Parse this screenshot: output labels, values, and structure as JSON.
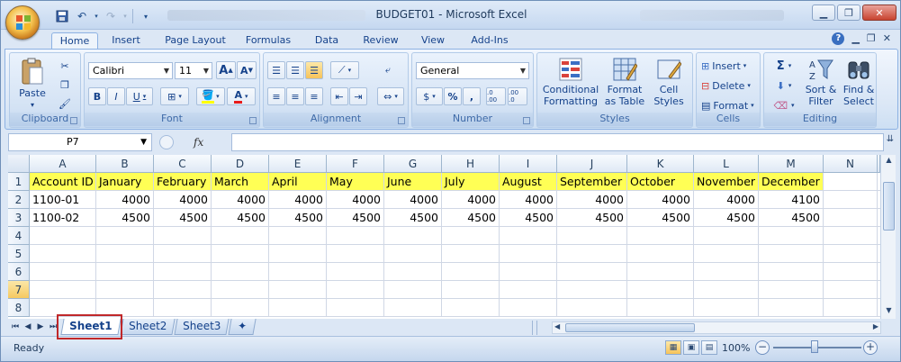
{
  "window": {
    "title": "BUDGET01 - Microsoft Excel"
  },
  "tabs": [
    "Home",
    "Insert",
    "Page Layout",
    "Formulas",
    "Data",
    "Review",
    "View",
    "Add-Ins"
  ],
  "ribbon": {
    "clipboard": {
      "label": "Clipboard",
      "paste": "Paste"
    },
    "font": {
      "label": "Font",
      "name": "Calibri",
      "size": "11",
      "bold": "B",
      "italic": "I",
      "underline": "U",
      "grow": "A",
      "shrink": "A"
    },
    "alignment": {
      "label": "Alignment"
    },
    "number": {
      "label": "Number",
      "format": "General",
      "currency": "$",
      "percent": "%",
      "comma": ",",
      "inc_dec": ".0 .00",
      "dec_dec": ".00 .0"
    },
    "styles": {
      "label": "Styles",
      "conditional": "Conditional Formatting",
      "format_table": "Format as Table",
      "cell_styles": "Cell Styles"
    },
    "cells": {
      "label": "Cells",
      "insert": "Insert",
      "delete": "Delete",
      "format": "Format"
    },
    "editing": {
      "label": "Editing",
      "sum": "Σ",
      "sort": "Sort & Filter",
      "find": "Find & Select"
    }
  },
  "formula_bar": {
    "name_box": "P7",
    "fx": "fx",
    "formula": ""
  },
  "columns": [
    "A",
    "B",
    "C",
    "D",
    "E",
    "F",
    "G",
    "H",
    "I",
    "J",
    "K",
    "L",
    "M",
    "N"
  ],
  "rows": [
    "1",
    "2",
    "3",
    "4",
    "5",
    "6",
    "7",
    "8"
  ],
  "sheet": {
    "header": [
      "Account ID",
      "January",
      "February",
      "March",
      "April",
      "May",
      "June",
      "July",
      "August",
      "September",
      "October",
      "November",
      "December"
    ],
    "data": [
      [
        "1100-01",
        "4000",
        "4000",
        "4000",
        "4000",
        "4000",
        "4000",
        "4000",
        "4000",
        "4000",
        "4000",
        "4000",
        "4100"
      ],
      [
        "1100-02",
        "4500",
        "4500",
        "4500",
        "4500",
        "4500",
        "4500",
        "4500",
        "4500",
        "4500",
        "4500",
        "4500",
        "4500"
      ]
    ]
  },
  "sheet_tabs": [
    "Sheet1",
    "Sheet2",
    "Sheet3"
  ],
  "status": {
    "ready": "Ready",
    "zoom": "100%",
    "minus": "−",
    "plus": "+"
  },
  "colors": {
    "highlight": "#ffff55",
    "selected_row": "#f5c960",
    "tab_outline": "#c0282a"
  }
}
